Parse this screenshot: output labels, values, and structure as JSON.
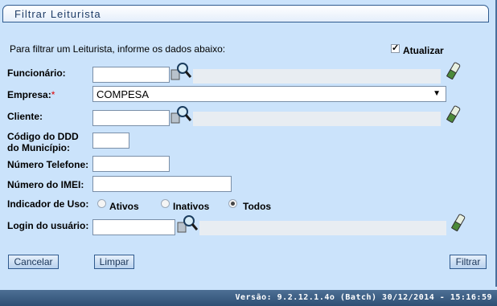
{
  "title": "Filtrar Leiturista",
  "instructions": "Para filtrar um Leiturista, informe os dados abaixo:",
  "atualizar": {
    "label": "Atualizar",
    "checked": true
  },
  "fields": {
    "funcionario": {
      "label": "Funcionário:",
      "value": ""
    },
    "empresa": {
      "label": "Empresa:",
      "required_mark": "*",
      "selected": "COMPESA"
    },
    "cliente": {
      "label": "Cliente:",
      "value": ""
    },
    "ddd": {
      "label_line1": "Código do DDD",
      "label_line2": "do Município:",
      "value": ""
    },
    "telefone": {
      "label": "Número Telefone:",
      "value": ""
    },
    "imei": {
      "label": "Número do IMEI:",
      "value": ""
    },
    "indicador": {
      "label": "Indicador de Uso:",
      "options": [
        "Ativos",
        "Inativos",
        "Todos"
      ],
      "selected": "Todos"
    },
    "login": {
      "label": "Login do usuário:",
      "value": ""
    }
  },
  "buttons": {
    "cancelar": "Cancelar",
    "limpar": "Limpar",
    "filtrar": "Filtrar"
  },
  "version": "Versão: 9.2.12.1.4o (Batch) 30/12/2014 - 15:16:59"
}
